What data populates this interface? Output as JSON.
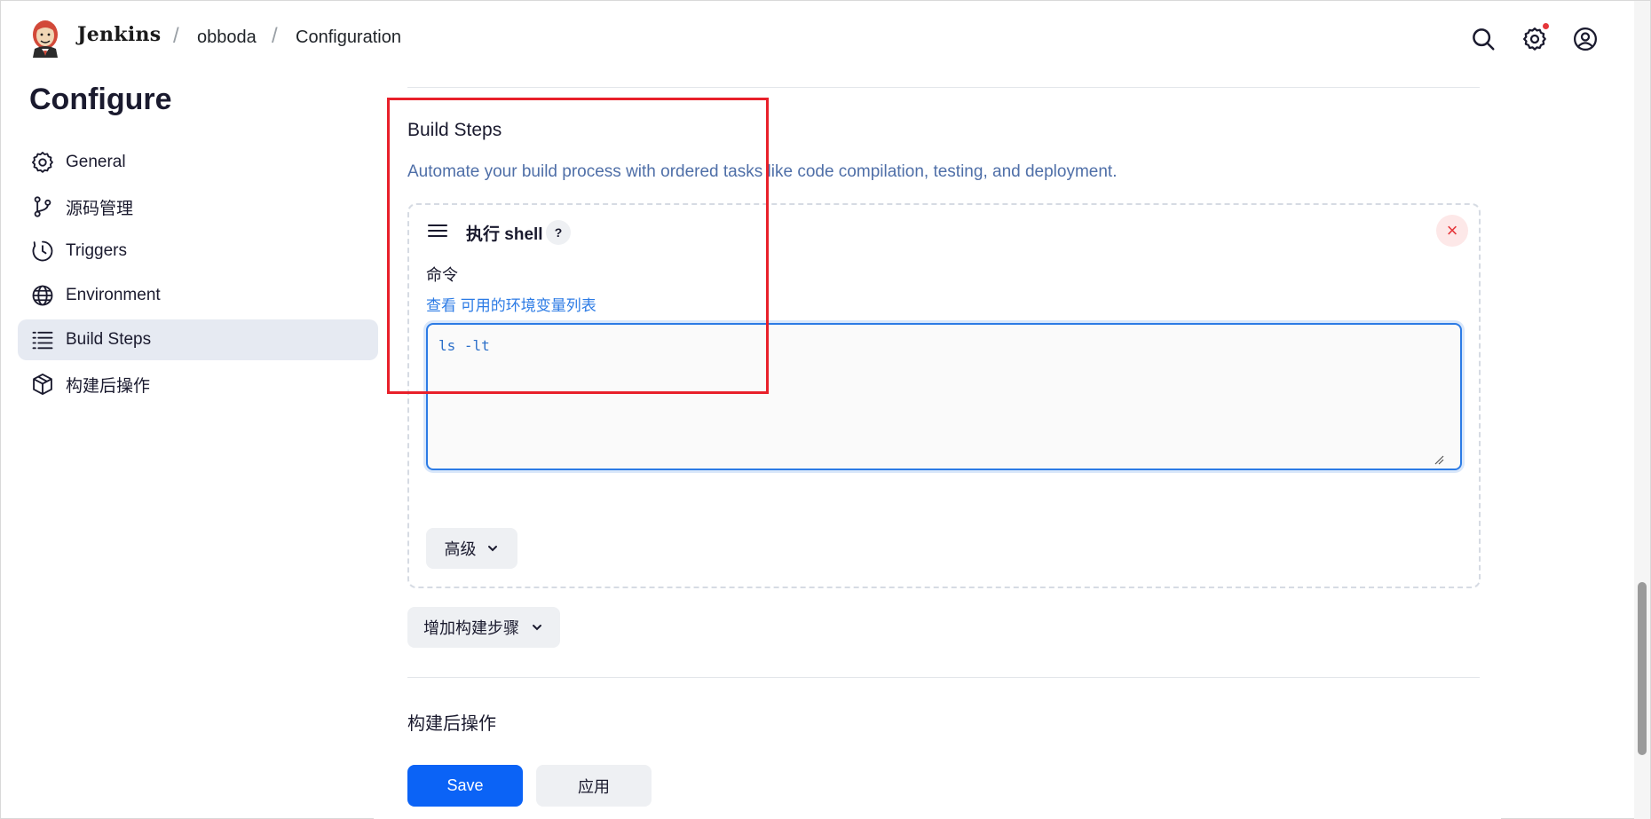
{
  "header": {
    "brand": "Jenkins",
    "breadcrumbs": [
      "obboda",
      "Configuration"
    ],
    "icons": [
      "search-icon",
      "settings-icon",
      "user-icon"
    ],
    "notification_color": "#e5363a"
  },
  "sidebar": {
    "title": "Configure",
    "items": [
      {
        "label": "General",
        "icon": "gear-icon"
      },
      {
        "label": "源码管理",
        "icon": "git-branch-icon"
      },
      {
        "label": "Triggers",
        "icon": "clock-icon"
      },
      {
        "label": "Environment",
        "icon": "globe-icon"
      },
      {
        "label": "Build Steps",
        "icon": "list-icon",
        "active": true
      },
      {
        "label": "构建后操作",
        "icon": "package-icon"
      }
    ]
  },
  "main": {
    "section_title": "Build Steps",
    "section_desc": "Automate your build process with ordered tasks like code compilation, testing, and deployment.",
    "step": {
      "title": "执行 shell",
      "help": "?",
      "close": "×",
      "field_label": "命令",
      "env_prefix": "查看",
      "env_link": "可用的环境变量列表",
      "command": "ls -lt",
      "advanced_label": "高级"
    },
    "add_step_label": "增加构建步骤",
    "post_section_title": "构建后操作"
  },
  "footer": {
    "save_label": "Save",
    "apply_label": "应用"
  },
  "colors": {
    "primary": "#0b63f6",
    "link": "#2c7be5",
    "highlight": "#e8202a",
    "active_bg": "#e6eaf2"
  }
}
